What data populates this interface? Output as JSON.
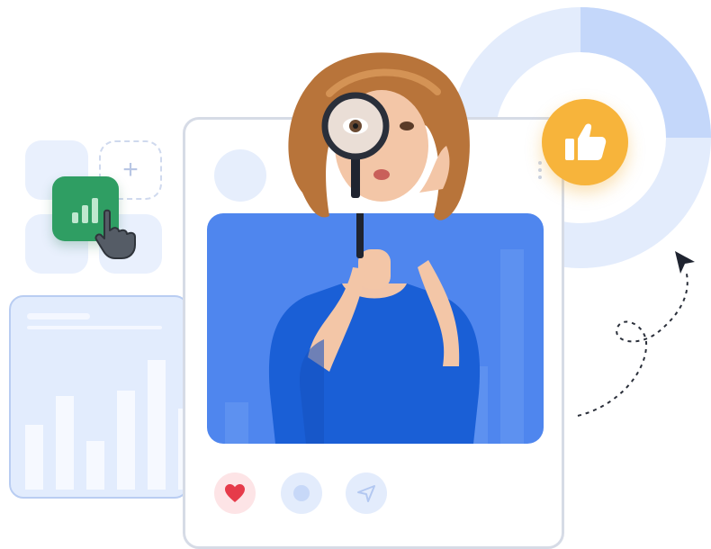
{
  "colors": {
    "primary_blue": "#2c6fe8",
    "light_blue": "#dfe9fd",
    "accent_green": "#2f9e63",
    "accent_yellow": "#f7b43b",
    "heart_red": "#e63b4a",
    "card_border": "#d6dbe6"
  },
  "icons": {
    "chart_app": "bar-chart-icon",
    "cursor_hand": "pointer-hand-icon",
    "add": "plus-icon",
    "like": "thumbs-up-icon",
    "arrow": "arrow-cursor-icon",
    "heart": "heart-icon",
    "comment": "comment-icon",
    "share": "send-icon",
    "magnifier": "magnifying-glass-icon"
  },
  "stats_panel": {
    "bar_levels": [
      0.36,
      0.52,
      0.27,
      0.55,
      0.72,
      0.45
    ]
  },
  "donut": {
    "segments": [
      0.25,
      0.75
    ]
  }
}
